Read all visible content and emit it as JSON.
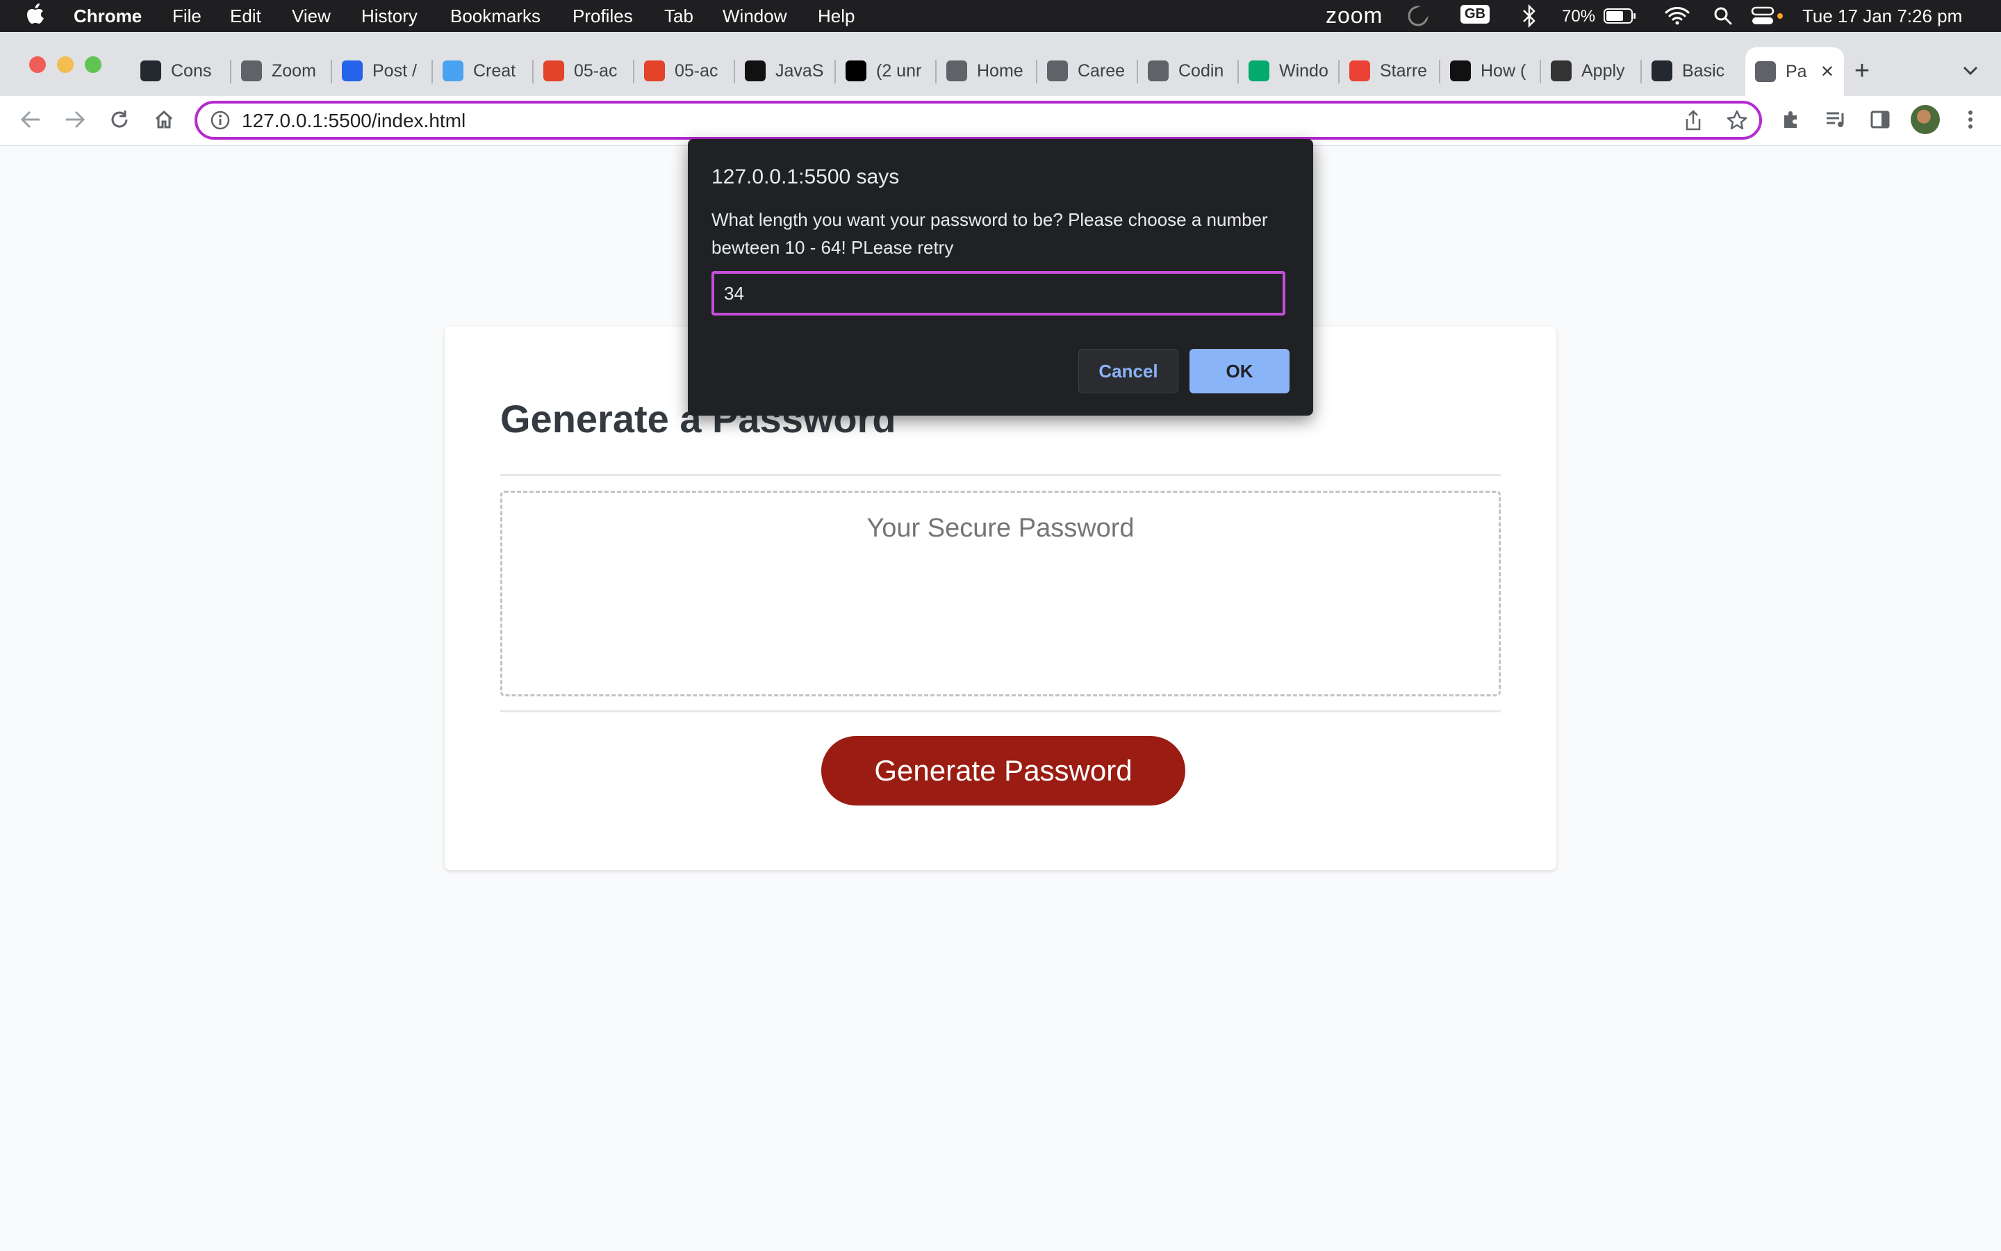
{
  "menubar": {
    "app": "Chrome",
    "items": [
      "File",
      "Edit",
      "View",
      "History",
      "Bookmarks",
      "Profiles",
      "Tab",
      "Window",
      "Help"
    ],
    "zoom": "zoom",
    "input_source": "GB",
    "battery": "70%",
    "clock": "Tue 17 Jan  7:26 pm"
  },
  "tabs": [
    {
      "title": "Cons",
      "icon": "github-icon",
      "color": "#24292f"
    },
    {
      "title": "Zoom",
      "icon": "edx-icon",
      "color": "#5f6368"
    },
    {
      "title": "Post /",
      "icon": "zoho-icon",
      "color": "#2563eb"
    },
    {
      "title": "Creat",
      "icon": "circle-icon",
      "color": "#4aa3f0"
    },
    {
      "title": "05-ac",
      "icon": "gitlab-icon",
      "color": "#e24329"
    },
    {
      "title": "05-ac",
      "icon": "gitlab-icon",
      "color": "#e24329"
    },
    {
      "title": "JavaS",
      "icon": "mdn-icon",
      "color": "#111111"
    },
    {
      "title": "(2 unr",
      "icon": "aol-icon",
      "color": "#000000"
    },
    {
      "title": "Home",
      "icon": "edx-icon",
      "color": "#5f6368"
    },
    {
      "title": "Caree",
      "icon": "edx-icon",
      "color": "#5f6368"
    },
    {
      "title": "Codin",
      "icon": "edx-icon",
      "color": "#5f6368"
    },
    {
      "title": "Windo",
      "icon": "w3schools-icon",
      "color": "#04aa6d"
    },
    {
      "title": "Starre",
      "icon": "gmail-icon",
      "color": "#ea4335"
    },
    {
      "title": "How (",
      "icon": "crown-icon",
      "color": "#111111"
    },
    {
      "title": "Apply",
      "icon": "bird-icon",
      "color": "#333333"
    },
    {
      "title": "Basic",
      "icon": "github-icon",
      "color": "#24292f"
    },
    {
      "title": "Pa",
      "icon": "globe-icon",
      "color": "#5f6368",
      "active": true
    }
  ],
  "address": {
    "url": "127.0.0.1:5500/index.html"
  },
  "page": {
    "title": "Generate a Password",
    "password_placeholder": "Your Secure Password",
    "password_value": "",
    "generate_label": "Generate Password",
    "accent_color": "#9b1c12"
  },
  "dialog": {
    "origin": "127.0.0.1:5500 says",
    "message": "What length you want your password to be? Please choose a number bewteen 10 - 64! PLease retry",
    "input_value": "34",
    "cancel_label": "Cancel",
    "ok_label": "OK"
  }
}
